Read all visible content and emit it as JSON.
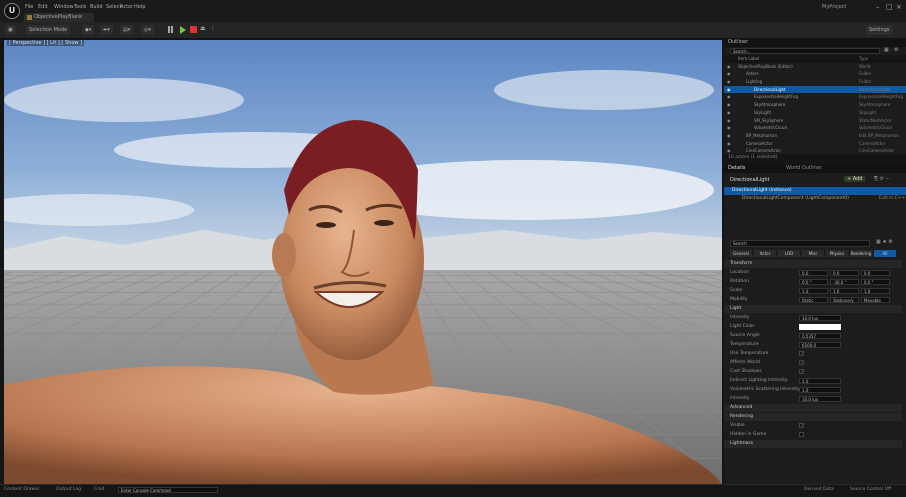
{
  "app": {
    "logo_text": "U",
    "tab_title": "ObjectivePlayBlank",
    "project_name": "MyProject"
  },
  "menu": [
    "File",
    "Edit",
    "Window",
    "Tools",
    "Build",
    "Select",
    "Actor",
    "Help"
  ],
  "toolbar": {
    "save": "Save",
    "mode": "Selection Mode",
    "platforms": "Platforms",
    "settings": "Settings"
  },
  "viewport": {
    "label": "[ Perspective ] [ Lit ] [ Show ]"
  },
  "outliner": {
    "tab": "Outliner",
    "search_placeholder": "Search...",
    "col_label": "Item Label",
    "col_type": "Type",
    "rows": [
      {
        "label": "ObjectivePlayBlank (Editor)",
        "type": "World"
      },
      {
        "label": "Actors",
        "type": "Folder"
      },
      {
        "label": "Lighting",
        "type": "Folder"
      },
      {
        "label": "DirectionalLight",
        "type": "DirectionalLight"
      },
      {
        "label": "ExponentialHeightFog",
        "type": "ExponentialHeightFog"
      },
      {
        "label": "SkyAtmosphere",
        "type": "SkyAtmosphere"
      },
      {
        "label": "SkyLight",
        "type": "SkyLight"
      },
      {
        "label": "SM_SkySphere",
        "type": "StaticMeshActor"
      },
      {
        "label": "VolumetricCloud",
        "type": "VolumetricCloud"
      },
      {
        "label": "BP_Metahuman",
        "type": "Edit BP_Metahuman"
      },
      {
        "label": "CameraActor",
        "type": "CameraActor"
      },
      {
        "label": "CineCameraActor",
        "type": "CineCameraActor"
      }
    ],
    "status": "10 actors (1 selected)"
  },
  "details": {
    "tabs": [
      "Details",
      "World Outliner"
    ],
    "actor_name": "DirectionalLight",
    "add_label": "+ Add",
    "component_root": "DirectionalLight (Instance)",
    "component_child": "DirectionalLightComponent (LightComponent0)",
    "edit_in_cpp": "Edit in C++",
    "search_placeholder": "Search",
    "filter_tabs": [
      "General",
      "Actor",
      "LOD",
      "Misc",
      "Physics",
      "Rendering",
      "All"
    ],
    "sections": {
      "transform": "Transform",
      "light": "Light",
      "advanced": "Advanced",
      "rendering": "Rendering",
      "lightmass": "Lightmass"
    },
    "transform": [
      {
        "label": "Location",
        "values": [
          "0.0",
          "0.0",
          "0.0"
        ]
      },
      {
        "label": "Rotation",
        "values": [
          "0.0 °",
          "-30.0 °",
          "0.0 °"
        ]
      },
      {
        "label": "Scale",
        "values": [
          "1.0",
          "1.0",
          "1.0"
        ]
      },
      {
        "label": "Mobility",
        "values": [
          "Static",
          "Stationary",
          "Movable"
        ]
      }
    ],
    "light": [
      {
        "label": "Intensity",
        "value": "10.0 lux"
      },
      {
        "label": "Light Color",
        "value": ""
      },
      {
        "label": "Source Angle",
        "value": "0.5357"
      },
      {
        "label": "Temperature",
        "value": "6500.0"
      },
      {
        "label": "Use Temperature",
        "value": ""
      },
      {
        "label": "Affects World",
        "value": ""
      },
      {
        "label": "Cast Shadows",
        "value": ""
      },
      {
        "label": "Indirect Lighting Intensity",
        "value": "1.0"
      },
      {
        "label": "Volumetric Scattering Intensity",
        "value": "1.0"
      },
      {
        "label": "Intensity",
        "value": "10.0 lux"
      }
    ],
    "rendering": [
      {
        "label": "Visible"
      },
      {
        "label": "Hidden in Game"
      }
    ]
  },
  "statusbar": {
    "content_drawer": "Content Drawer",
    "output_log": "Output Log",
    "cmd": "Cmd",
    "cmd_placeholder": "Enter Console Command",
    "derived_data": "Derived Data",
    "source_control": "Source Control Off"
  }
}
